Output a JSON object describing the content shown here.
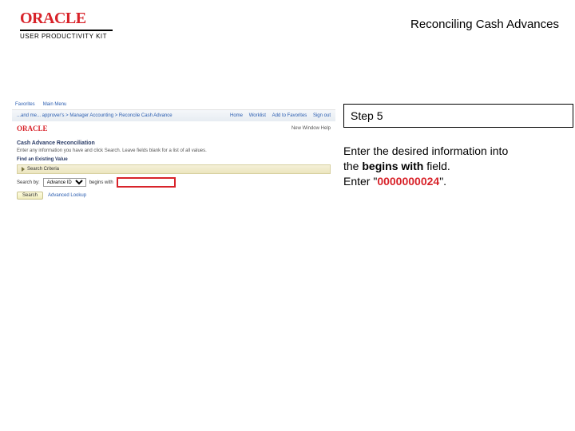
{
  "header": {
    "brand": "ORACLE",
    "kit": "USER PRODUCTIVITY KIT",
    "doc_title": "Reconciling Cash Advances"
  },
  "step": {
    "label": "Step 5"
  },
  "instruction": {
    "line1_a": "Enter the desired information into",
    "line2_a": "the ",
    "line2_b": "begins with",
    "line2_c": " field.",
    "line3_a": "Enter \"",
    "line3_val": "0000000024",
    "line3_b": "\"."
  },
  "app": {
    "fav1": "Favorites",
    "fav2": "Main Menu",
    "crumbs": "...and me... approver's  >  Manager Accounting  >  Reconcile Cash Advance",
    "nav_home": "Home",
    "nav_wl": "Worklist",
    "nav_add": "Add to Favorites",
    "nav_out": "Sign out",
    "brand": "ORACLE",
    "userline": "New Window  Help",
    "page_title": "Cash Advance Reconciliation",
    "page_sub": "Enter any information you have and click Search. Leave fields blank for a list of all values.",
    "find_label": "Find an Existing Value",
    "sc_label": "Search Criteria",
    "search_by": "Search by:",
    "search_sel": "Advance ID",
    "op": "begins with",
    "btn_search": "Search",
    "adv": "Advanced Lookup"
  }
}
